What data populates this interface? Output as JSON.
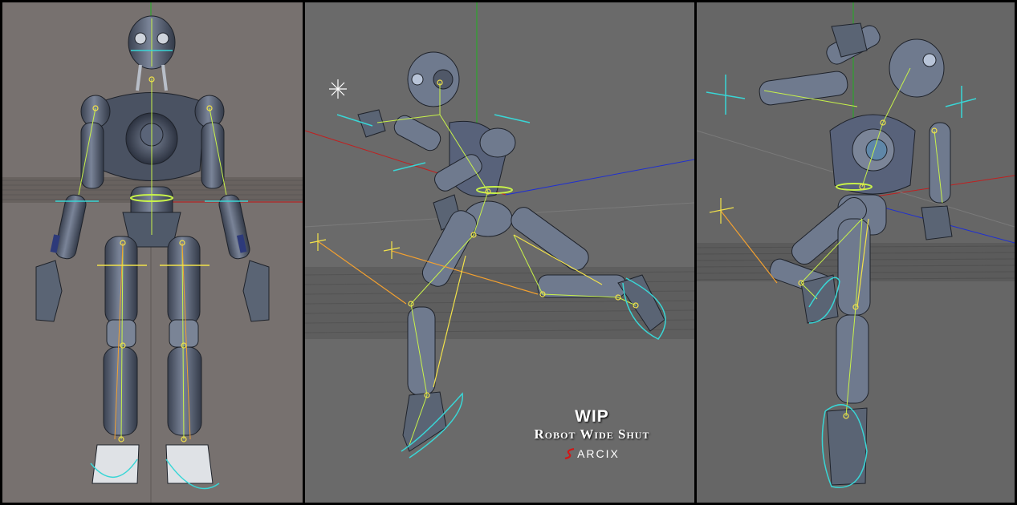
{
  "caption": {
    "title": "WIP",
    "subtitle": "Robot Wide Shut",
    "logo_text": "ARCIX"
  },
  "colors": {
    "bone_line": "#c8f24a",
    "ik_handle": "#39d6d6",
    "ik_chain": "#f2a030",
    "joint_marker": "#f2e24a",
    "axis_x": "#d02020",
    "axis_y": "#20b020",
    "axis_z": "#2030d0",
    "logo_red": "#d01818"
  },
  "panels": [
    {
      "name": "front-view",
      "pose": "T-stance"
    },
    {
      "name": "side-view",
      "pose": "running"
    },
    {
      "name": "back-view",
      "pose": "kick"
    }
  ]
}
